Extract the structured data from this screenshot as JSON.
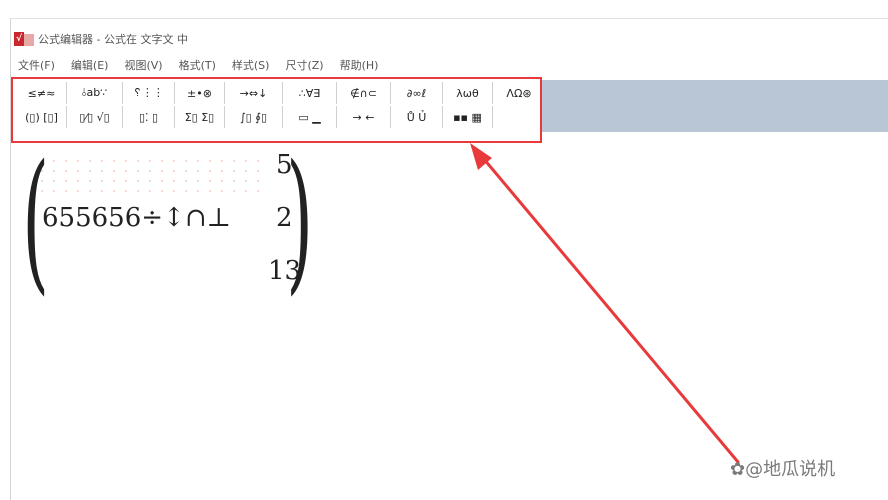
{
  "window": {
    "title": "公式编辑器 - 公式在 文字文 中"
  },
  "menu": [
    "文件(F)",
    "编辑(E)",
    "视图(V)",
    "格式(T)",
    "样式(S)",
    "尺寸(Z)",
    "帮助(H)"
  ],
  "toolbar": {
    "row1": [
      "≤≠≈",
      "⫰ab∵",
      "␦⋮⋮",
      "±•⊗",
      "→⇔↓",
      "∴∀∃",
      "∉∩⊂",
      "∂∞ℓ",
      "λωθ",
      "ΛΩ⊛"
    ],
    "row2": [
      "(▯) [▯]",
      "▯⁄▯ √▯",
      "▯⁚ ▯",
      "Σ▯ Σ▯",
      "∫▯ ∮▯",
      "▭ ▁",
      "→ ←",
      "Ů Ủ",
      "▪▪ ▦"
    ]
  },
  "formula": {
    "top": "5",
    "middle_left": "655656÷↕∩⊥",
    "middle_right": "2",
    "bottom": "13"
  },
  "watermark": "@地瓜说机",
  "colors": {
    "highlight": "#e83a3a",
    "toolbar_strip": "#b9c6d6"
  }
}
